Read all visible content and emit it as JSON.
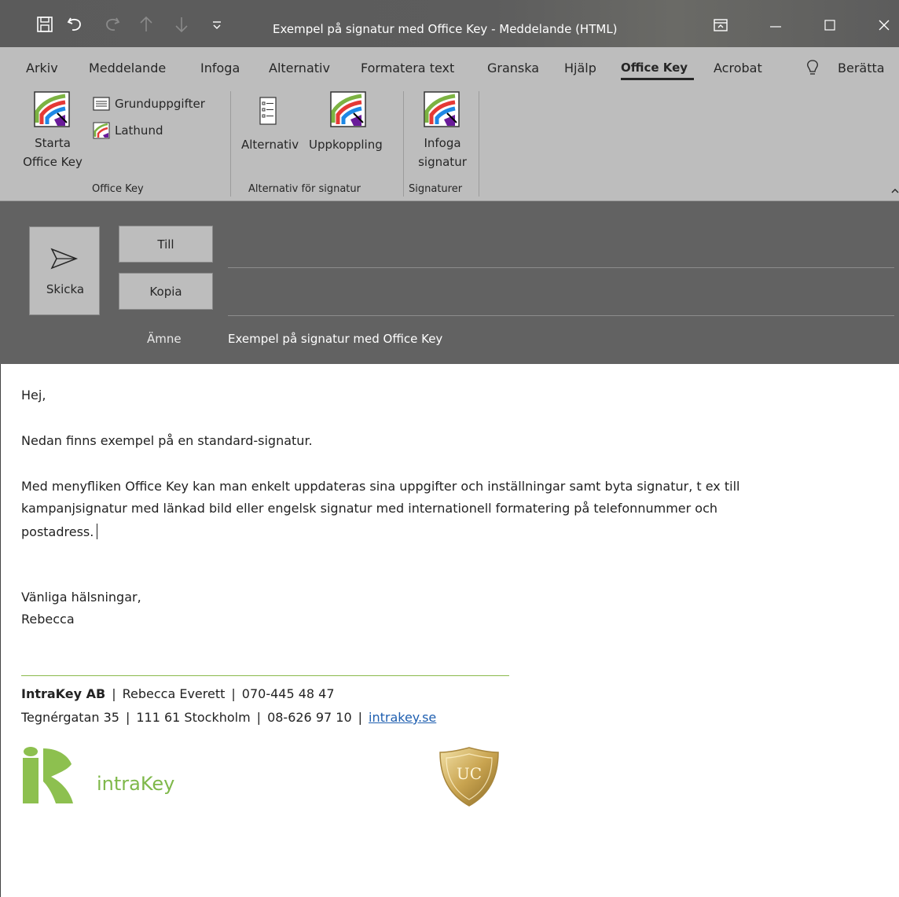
{
  "window": {
    "title": "Exempel på signatur med Office Key  -  Meddelande (HTML)",
    "qat": [
      "save-icon",
      "undo-icon",
      "redo-icon",
      "up-arrow-icon",
      "down-arrow-icon",
      "customize-icon"
    ]
  },
  "tabs": [
    {
      "label": "Arkiv"
    },
    {
      "label": "Meddelande"
    },
    {
      "label": "Infoga"
    },
    {
      "label": "Alternativ"
    },
    {
      "label": "Formatera text"
    },
    {
      "label": "Granska"
    },
    {
      "label": "Hjälp"
    },
    {
      "label": "Office Key",
      "active": true
    },
    {
      "label": "Acrobat"
    },
    {
      "label": "Berätta"
    }
  ],
  "ribbon": {
    "start_line1": "Starta",
    "start_line2": "Office Key",
    "grunduppgifter": "Grunduppgifter",
    "lathund": "Lathund",
    "group1": "Office Key",
    "alternativ": "Alternativ",
    "uppkoppling": "Uppkoppling",
    "group2": "Alternativ för signatur",
    "infoga_line1": "Infoga",
    "infoga_line2": "signatur",
    "group3": "Signaturer"
  },
  "compose": {
    "send": "Skicka",
    "to": "Till",
    "cc": "Kopia",
    "subject_label": "Ämne",
    "subject": "Exempel på signatur med Office Key"
  },
  "message": {
    "greeting": "Hej,",
    "line1": "Nedan finns exempel på en standard-signatur.",
    "line2a": "Med menyfliken Office Key kan man enkelt uppdateras sina uppgifter och inställningar samt byta signatur, t ex till",
    "line2b": "kampanjsignatur med länkad bild eller engelsk signatur med internationell formatering på telefonnummer och",
    "line2c": "postadress.",
    "closing": "Vänliga hälsningar,",
    "name": "Rebecca"
  },
  "signature": {
    "company": "IntraKey AB",
    "person": "Rebecca Everett",
    "mobile": "070-445 48 47",
    "street": "Tegnérgatan 35",
    "city": "111 61 Stockholm",
    "phone": "08-626 97 10",
    "web": "intrakey.se",
    "logo_text": "intraKey",
    "badge_text": "UC",
    "separator": "|"
  },
  "colors": {
    "titlebar": "#5b5b5b",
    "ribbon": "#bdbdbd",
    "header": "#626262",
    "brand_green": "#7fb84a",
    "link": "#1f5fb0"
  }
}
